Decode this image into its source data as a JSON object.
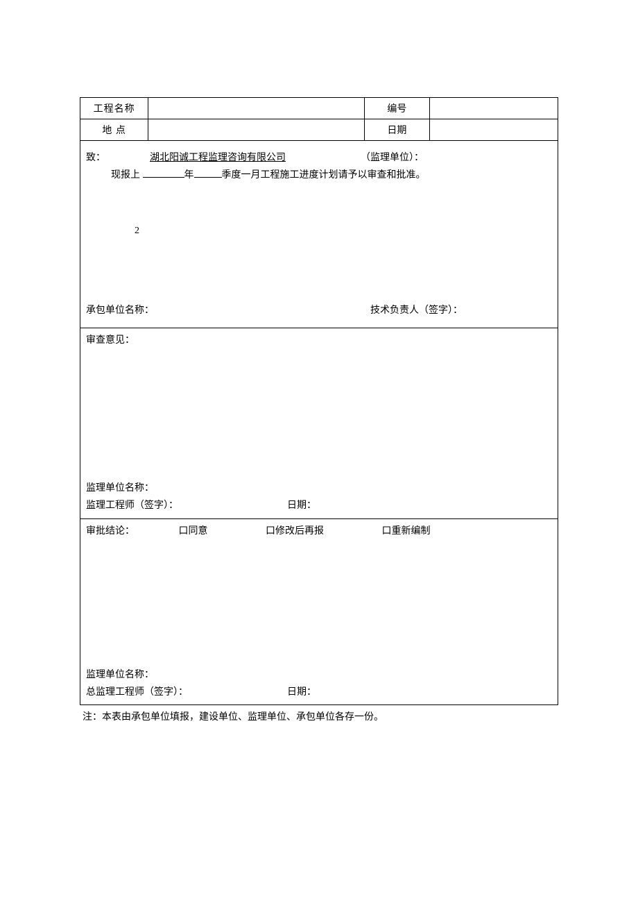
{
  "header": {
    "projectNameLabel": "工程名称",
    "numberLabel": "编号",
    "locationLabel": "地 点",
    "dateLabel": "日期"
  },
  "section1": {
    "toLabel": "致：",
    "company": "湖北阳诚工程监理咨询有限公司",
    "unitTypeLabel": "（监理单位）：",
    "reportPrefix": "现报上",
    "yearSuffix": "年",
    "quarterSuffix": "季度一月工程施工进度计划请予以审查和批准。",
    "num": "2",
    "contractorLabel": "承包单位名称：",
    "techLeadLabel": "技术负责人（签字）："
  },
  "section2": {
    "title": "审查意见：",
    "supervisionUnitLabel": "监理单位名称：",
    "engineerSignLabel": "监理工程师（签字）：",
    "dateLabel": "日期："
  },
  "section3": {
    "conclusionLabel": "审批结论：",
    "opt1": "口同意",
    "opt2": "口修改后再报",
    "opt3": "口重新编制",
    "supervisionUnitLabel": "监理单位名称：",
    "chiefEngineerSignLabel": "总监理工程师（签字）：",
    "dateLabel": "日期："
  },
  "footerNote": "注：本表由承包单位填报，建设单位、监理单位、承包单位各存一份。"
}
